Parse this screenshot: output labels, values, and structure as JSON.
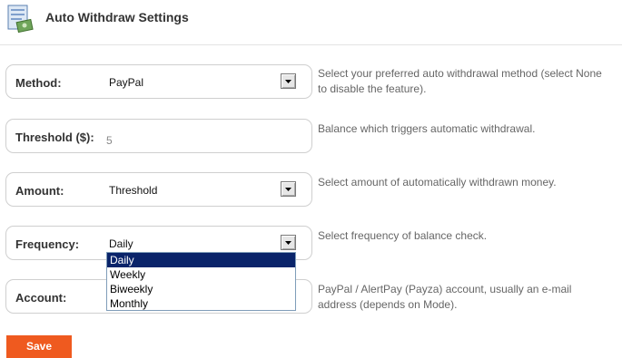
{
  "header": {
    "title": "Auto Withdraw Settings",
    "icon": "withdraw-settings-icon"
  },
  "form": {
    "method": {
      "label": "Method:",
      "value": "PayPal",
      "help_line1": "Select your preferred auto withdrawal method (select None",
      "help_line2": "to disable the feature)."
    },
    "threshold": {
      "label": "Threshold ($):",
      "value": "5",
      "help": "Balance which triggers automatic withdrawal."
    },
    "amount": {
      "label": "Amount:",
      "value": "Threshold",
      "help": "Select amount of automatically withdrawn money."
    },
    "frequency": {
      "label": "Frequency:",
      "value": "Daily",
      "help": "Select frequency of balance check.",
      "options": [
        "Daily",
        "Weekly",
        "Biweekly",
        "Monthly"
      ],
      "highlighted": "Daily"
    },
    "account": {
      "label": "Account:",
      "help_line1": "PayPal / AlertPay (Payza) account, usually an e-mail",
      "help_line2": "address (depends on Mode)."
    }
  },
  "save_label": "Save"
}
